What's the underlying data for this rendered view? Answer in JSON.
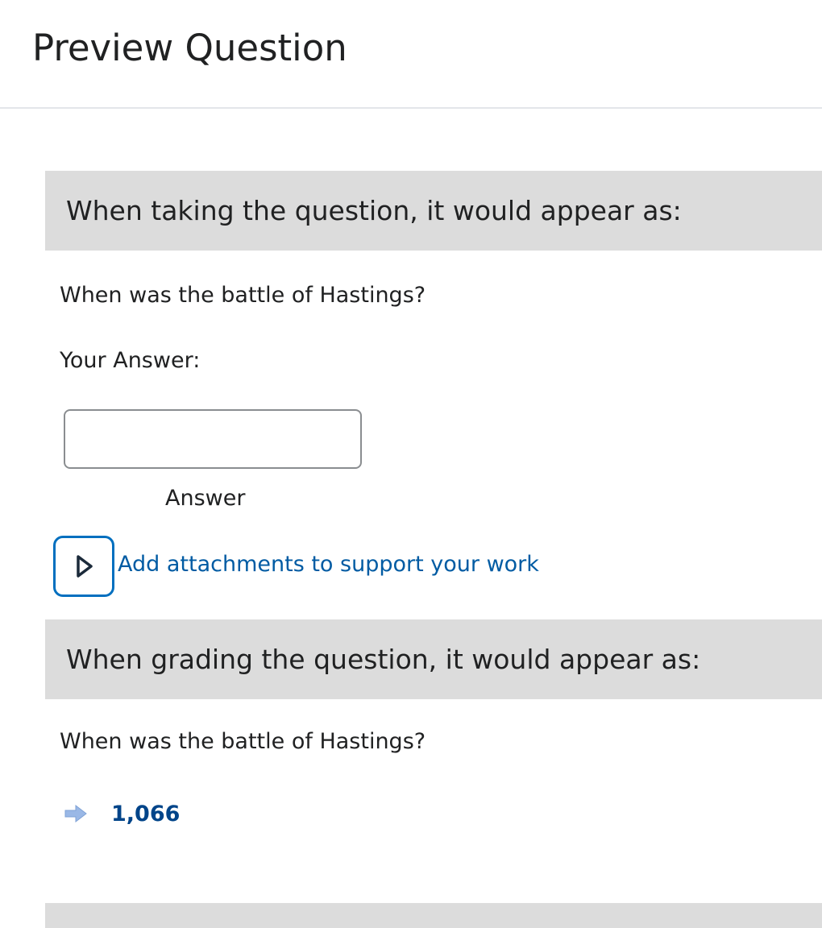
{
  "dialog": {
    "title": "Preview Question"
  },
  "taking": {
    "header": "When taking the question, it would appear as:",
    "question": "When was the battle of Hastings?",
    "answer_label": "Your Answer:",
    "input_value": "",
    "input_caption": "Answer",
    "attachments_link": "Add attachments to support your work"
  },
  "grading": {
    "header": "When grading the question, it would appear as:",
    "question": "When was the battle of Hastings?",
    "correct_answer": "1,066"
  },
  "icons": {
    "expand": "chevron-right-icon",
    "answer_arrow": "arrow-right-icon"
  },
  "colors": {
    "link": "#005ba3",
    "focus_ring": "#006fbf",
    "correct_answer": "#004489",
    "arrow": "#9ab8e6",
    "section_header_bg": "#dcdcdc"
  }
}
